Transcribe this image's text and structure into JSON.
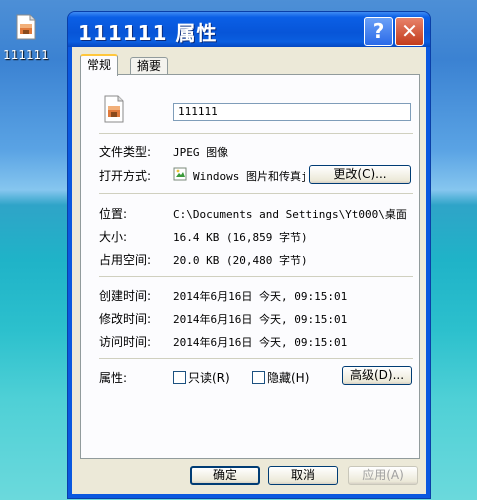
{
  "desktop": {
    "icon_label": "111111"
  },
  "window": {
    "title": "111111 属性",
    "help_glyph": "?",
    "close_glyph": "✕"
  },
  "tabs": [
    {
      "label": "常规"
    },
    {
      "label": "摘要"
    }
  ],
  "general": {
    "file_name": "111111",
    "file_type_label": "文件类型:",
    "file_type_value": "JPEG 图像",
    "open_with_label": "打开方式:",
    "open_with_value": "Windows 图片和传真j",
    "change_button": "更改(C)...",
    "location_label": "位置:",
    "location_value": "C:\\Documents and Settings\\Yt000\\桌面",
    "size_label": "大小:",
    "size_value": "16.4 KB (16,859 字节)",
    "disk_size_label": "占用空间:",
    "disk_size_value": "20.0 KB (20,480 字节)",
    "created_label": "创建时间:",
    "created_value": "2014年6月16日 今天, 09:15:01",
    "modified_label": "修改时间:",
    "modified_value": "2014年6月16日 今天, 09:15:01",
    "accessed_label": "访问时间:",
    "accessed_value": "2014年6月16日 今天, 09:15:01",
    "attributes_label": "属性:",
    "readonly_label": "只读(R)",
    "hidden_label": "隐藏(H)",
    "advanced_button": "高级(D)..."
  },
  "footer": {
    "ok": "确定",
    "cancel": "取消",
    "apply": "应用(A)"
  }
}
